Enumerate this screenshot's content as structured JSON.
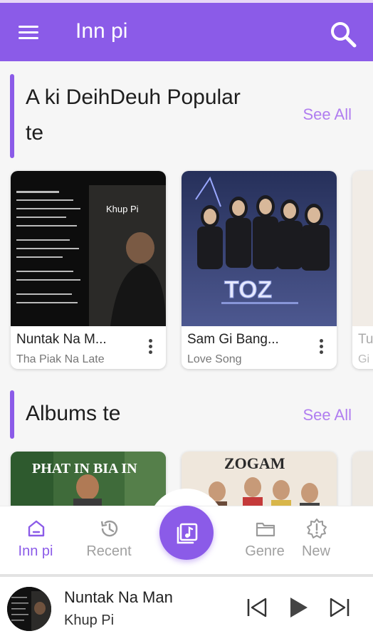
{
  "appbar": {
    "title": "Inn pi",
    "menu_icon": "menu-icon",
    "search_icon": "search-icon"
  },
  "colors": {
    "accent": "#8b5be8",
    "see_all": "#b07df0"
  },
  "popular": {
    "title_line1": "A ki DeihDeuh Popular",
    "title_line2": "te",
    "see_all": "See All",
    "cards": [
      {
        "title": "Nuntak Na M...",
        "subtitle": "Tha Piak Na Late",
        "art_text": "Khup Pi"
      },
      {
        "title": "Sam Gi Bang...",
        "subtitle": "Love Song",
        "art_text": "TOZ"
      },
      {
        "title": "Tu",
        "subtitle": "Gi"
      }
    ]
  },
  "albums": {
    "title": "Albums te",
    "see_all": "See All",
    "cards": [
      {
        "art_text": "PHAT IN BIA IN"
      },
      {
        "art_text": "ZOGAM"
      }
    ]
  },
  "bottom_nav": {
    "items": [
      {
        "label": "Inn pi",
        "icon": "home-icon",
        "active": true
      },
      {
        "label": "Recent",
        "icon": "history-icon"
      },
      {
        "label": "",
        "icon": "library-music-icon"
      },
      {
        "label": "Genre",
        "icon": "folder-icon"
      },
      {
        "label": "New",
        "icon": "new-release-icon"
      }
    ]
  },
  "player": {
    "title": "Nuntak Na Man",
    "artist": "Khup Pi"
  }
}
